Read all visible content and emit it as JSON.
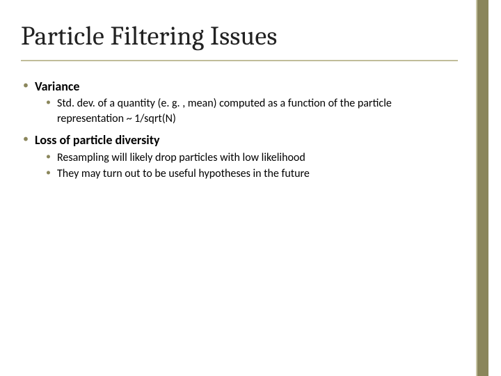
{
  "title": "Particle Filtering Issues",
  "sections": [
    {
      "heading": "Variance",
      "points": [
        "Std. dev. of a quantity (e. g. , mean) computed as a function of the particle representation ~ 1/sqrt(N)"
      ]
    },
    {
      "heading": "Loss of particle diversity",
      "points": [
        "Resampling will likely drop particles with low likelihood",
        "They may turn out to be useful hypotheses in the future"
      ]
    }
  ]
}
